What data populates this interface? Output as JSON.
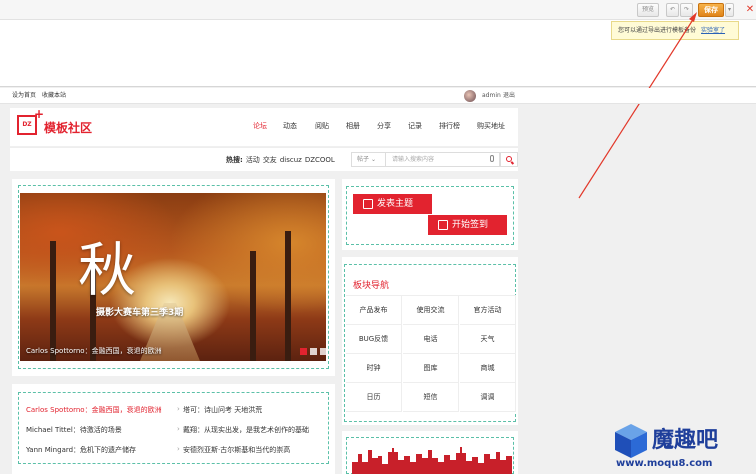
{
  "toolbar": {
    "preview_label": "预览",
    "undo_label": "↶",
    "redo_label": "↷",
    "save_label": "保存",
    "dropdown_label": "▾",
    "close_label": "✕",
    "tip_text": "您可以通过导出进行模板备份",
    "tip_link": "实验室了"
  },
  "userbar": {
    "set_home": "设为首页",
    "bookmark": "收藏本站",
    "username": "admin",
    "logout": "退出"
  },
  "header": {
    "logo_mark": "DZ",
    "logo_text": "模板社区",
    "nav": [
      "论坛",
      "动态",
      "阅贴",
      "相册",
      "分享",
      "记录",
      "排行榜",
      "购买地址"
    ]
  },
  "search": {
    "hot_label": "热搜:",
    "hot_items": [
      "活动",
      "交友",
      "discuz",
      "DZCOOL"
    ],
    "type_value": "帖子",
    "placeholder": "请输入搜索内容"
  },
  "slideshow": {
    "big_char": "秋",
    "subtitle": "摄影大赛车第三季3期",
    "caption": "Carlos Spottorno：金融西国，衰退的欧洲"
  },
  "actions": {
    "post_label": "发表主题",
    "signin_label": "开始签到"
  },
  "section_nav": {
    "title": "板块导航",
    "items": [
      "产品发布",
      "使用交流",
      "官方活动",
      "BUG反馈",
      "电话",
      "天气",
      "时钟",
      "图库",
      "商城",
      "日历",
      "短信",
      "调调"
    ]
  },
  "articles": {
    "left": [
      "Carlos Spottorno：金融西国，衰退的欧洲",
      "Michael Tittel：待激活的场景",
      "Yann Mingard：危机下的遗产储存"
    ],
    "right": [
      "塔可：诗山问考 天地洪荒",
      "戴翔：从现实出发，是我艺术创作的基础",
      "安德烈亚斯·古尔斯基和当代的崇高"
    ]
  },
  "watermark": {
    "brand": "魔趣吧",
    "url": "www.moqu8.com"
  },
  "colors": {
    "accent": "#e2232f",
    "save": "#e8921f",
    "guide_dash": "#5bc0a8"
  }
}
